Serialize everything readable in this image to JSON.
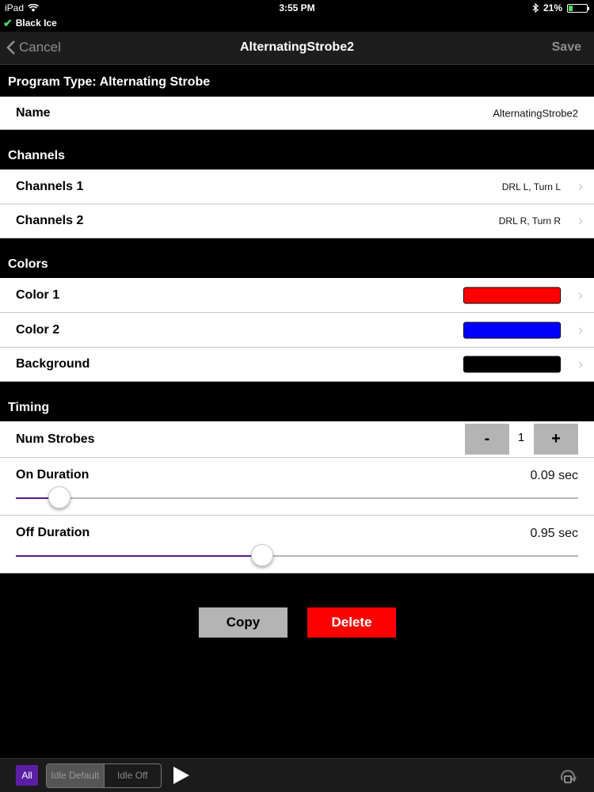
{
  "status_bar": {
    "device": "iPad",
    "time": "3:55 PM",
    "battery": "21%",
    "battery_fraction": 0.21,
    "connected_device": "Black Ice"
  },
  "nav": {
    "cancel_label": "Cancel",
    "title": "AlternatingStrobe2",
    "save_label": "Save"
  },
  "program_type_header": "Program Type: Alternating Strobe",
  "name_row": {
    "label": "Name",
    "value": "AlternatingStrobe2"
  },
  "channels": {
    "header": "Channels",
    "rows": [
      {
        "label": "Channels 1",
        "value": "DRL L, Turn L"
      },
      {
        "label": "Channels 2",
        "value": "DRL R, Turn R"
      }
    ]
  },
  "colors": {
    "header": "Colors",
    "rows": [
      {
        "label": "Color 1",
        "color": "#ff0000"
      },
      {
        "label": "Color 2",
        "color": "#0000ff"
      },
      {
        "label": "Background",
        "color": "#000000"
      }
    ]
  },
  "timing": {
    "header": "Timing",
    "num_strobes": {
      "label": "Num Strobes",
      "value": "1",
      "minus_label": "-",
      "plus_label": "+"
    },
    "on_duration": {
      "label": "On Duration",
      "value": "0.09 sec",
      "slider_fraction": 0.078
    },
    "off_duration": {
      "label": "Off Duration",
      "value": "0.95 sec",
      "slider_fraction": 0.438
    }
  },
  "actions": {
    "copy_label": "Copy",
    "delete_label": "Delete",
    "copy_color": "#b4b4b4",
    "delete_color": "#ff0000"
  },
  "toolbar": {
    "all_label": "All",
    "idle_default_label": "Idle Default",
    "idle_off_label": "Idle Off",
    "accent_color": "#5b1fa6"
  }
}
